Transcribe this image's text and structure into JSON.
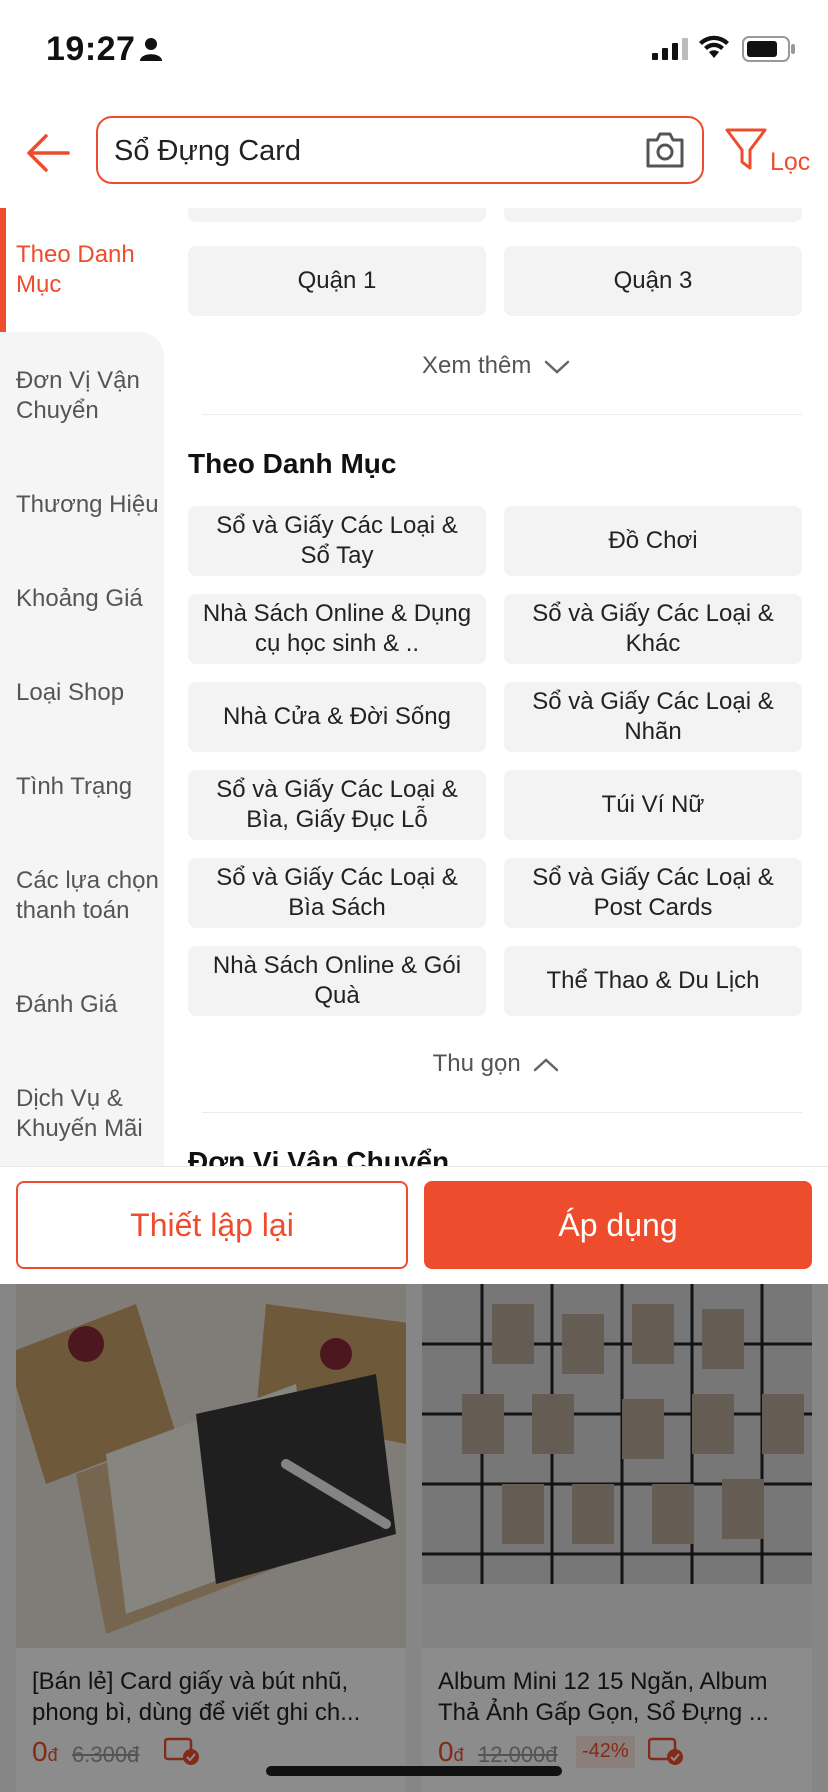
{
  "status_bar": {
    "time": "19:27"
  },
  "search": {
    "query": "Sổ Đựng Card",
    "filter_label": "Lọc"
  },
  "sidebar": {
    "items": [
      {
        "label": "Theo Danh Mục"
      },
      {
        "label": "Đơn Vị Vận Chuyển"
      },
      {
        "label": "Thương Hiệu"
      },
      {
        "label": "Khoảng Giá"
      },
      {
        "label": "Loại Shop"
      },
      {
        "label": "Tình Trạng"
      },
      {
        "label": "Các lựa chọn thanh toán"
      },
      {
        "label": "Đánh Giá"
      },
      {
        "label": "Dịch Vụ & Khuyến Mãi"
      }
    ]
  },
  "location": {
    "options": [
      "Quận 1",
      "Quận 3"
    ],
    "more_label": "Xem thêm"
  },
  "category": {
    "title": "Theo Danh Mục",
    "options": [
      "Sổ và Giấy Các Loại & Sổ Tay",
      "Đồ Chơi",
      "Nhà Sách Online & Dụng cụ học sinh & ..",
      "Sổ và Giấy Các Loại & Khác",
      "Nhà Cửa & Đời Sống",
      "Sổ và Giấy Các Loại & Nhãn",
      "Sổ và Giấy Các Loại & Bìa, Giấy Đục Lỗ",
      "Túi Ví Nữ",
      "Sổ và Giấy Các Loại & Bìa Sách",
      "Sổ và Giấy Các Loại & Post Cards",
      "Nhà Sách Online & Gói Quà",
      "Thể Thao & Du Lịch"
    ],
    "collapse_label": "Thu gọn"
  },
  "next_section_title": "Đơn Vị Vận Chuyển",
  "actions": {
    "reset_label": "Thiết lập lại",
    "apply_label": "Áp dụng"
  },
  "products": [
    {
      "title": "[Bán lẻ] Card giấy và bút nhũ, phong bì, dùng để viết ghi ch...",
      "price": "0",
      "currency": "đ",
      "old_price": "6.300đ"
    },
    {
      "title": "Album Mini 12 15 Ngăn, Album Thả Ảnh Gấp Gọn, Sổ Đựng ...",
      "price": "0",
      "currency": "đ",
      "old_price": "12.000đ",
      "discount": "-42%"
    }
  ],
  "colors": {
    "accent": "#ee4d2d",
    "sidebar_bg": "#f5f5f5",
    "chip_bg": "#f3f3f3"
  }
}
